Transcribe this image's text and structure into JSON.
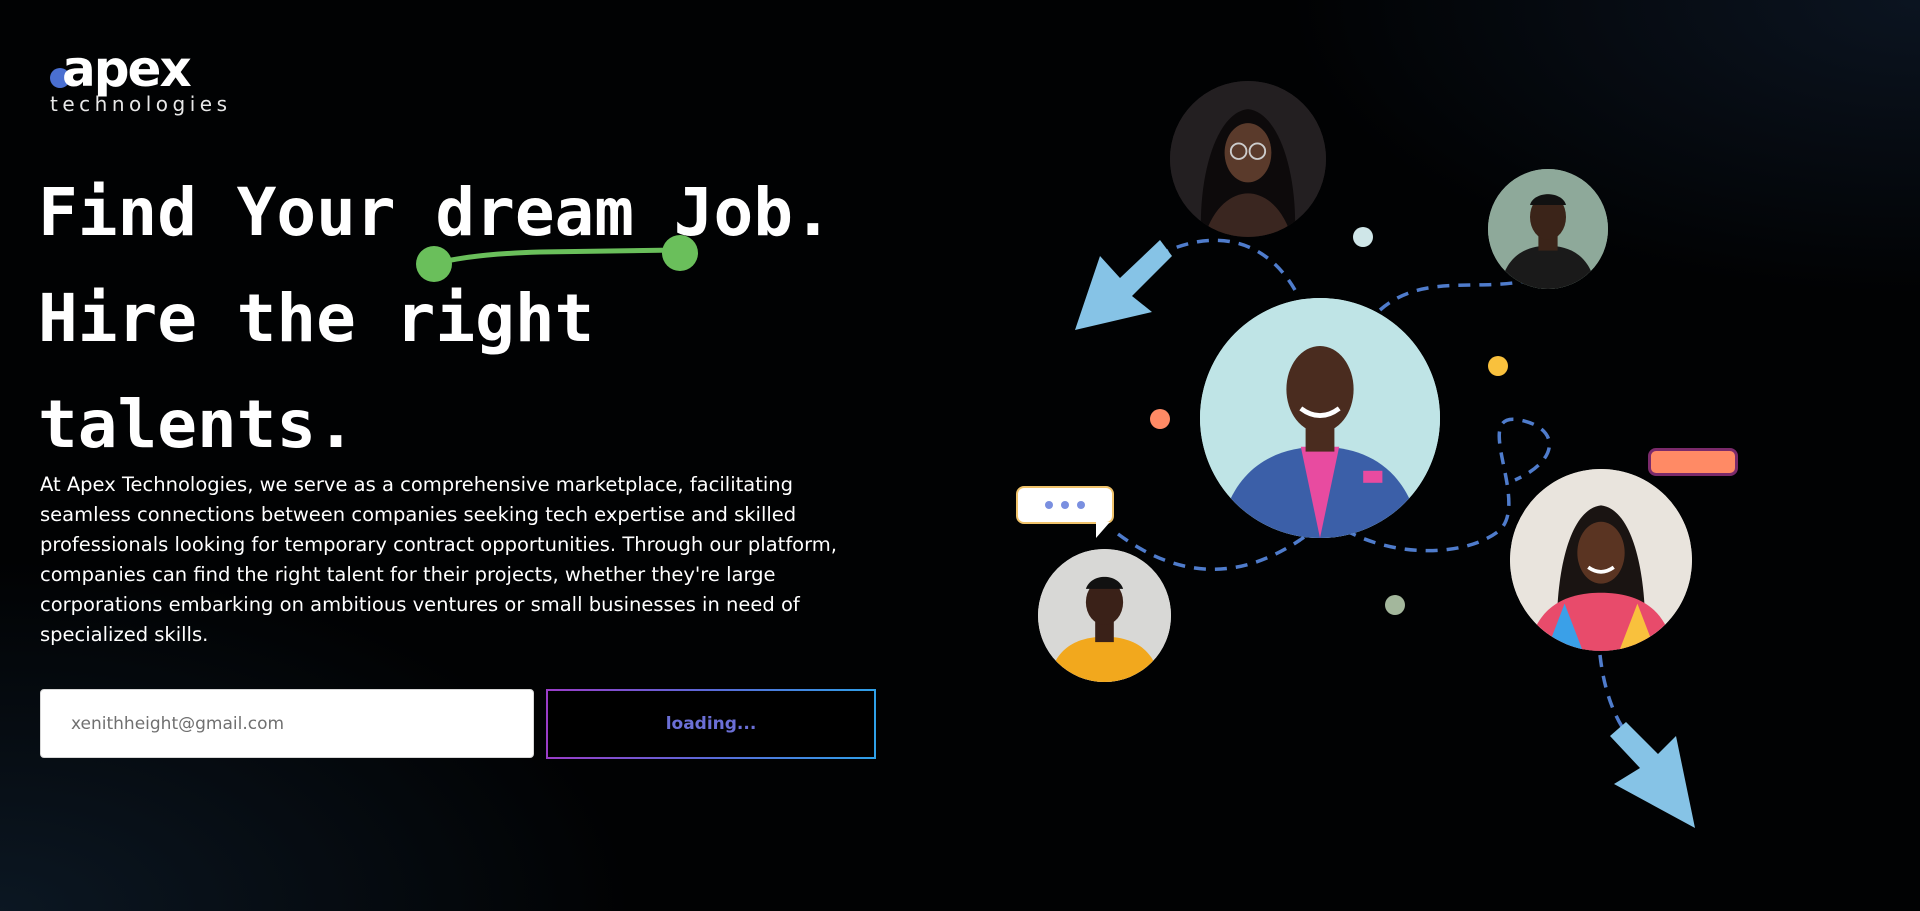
{
  "brand": {
    "logo_mark": "apex",
    "logo_sub": "technologies"
  },
  "hero": {
    "line1": "Find Your dream Job.",
    "line2": "Hire the right",
    "line3": "talents.",
    "description": "At Apex Technologies, we serve as a comprehensive marketplace, facilitating seamless connections between companies seeking tech expertise and skilled professionals looking for temporary contract opportunities. Through our platform, companies can find the right talent for their projects, whether they're large corporations embarking on ambitious ventures or small businesses in need of specialized skills."
  },
  "signup": {
    "email_placeholder": "xenithheight@gmail.com",
    "button_label": "loading..."
  },
  "colors": {
    "accent_green": "#6abf5b",
    "brand_blue": "#4a6fd1",
    "button_text": "#6b6fd6",
    "dashed_path": "#4f7ccc",
    "arrow_blue": "#86c3e6",
    "dot_orange": "#ff8a65",
    "dot_yellow": "#f9c13d"
  },
  "icons": {
    "chat": "typing-bubble-icon",
    "arrow": "arrow-icon"
  }
}
